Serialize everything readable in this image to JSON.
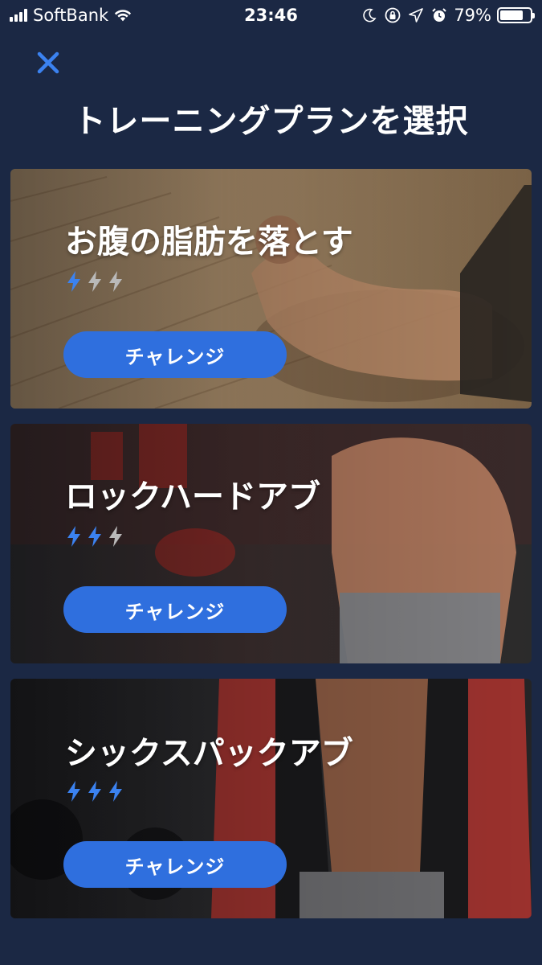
{
  "status_bar": {
    "carrier": "SoftBank",
    "time": "23:46",
    "battery_percent": "79%",
    "battery_level": 0.79,
    "icons": [
      "signal-icon",
      "wifi-icon",
      "moon-icon",
      "rotation-lock-icon",
      "location-icon",
      "alarm-icon",
      "battery-icon"
    ]
  },
  "header": {
    "close_icon": "close-icon",
    "title": "トレーニングプランを選択"
  },
  "plans": [
    {
      "title": "お腹の脂肪を落とす",
      "difficulty": 1,
      "max_difficulty": 3,
      "button_label": "チャレンジ"
    },
    {
      "title": "ロックハードアブ",
      "difficulty": 2,
      "max_difficulty": 3,
      "button_label": "チャレンジ"
    },
    {
      "title": "シックスパックアブ",
      "difficulty": 3,
      "max_difficulty": 3,
      "button_label": "チャレンジ"
    }
  ],
  "colors": {
    "background": "#1b2844",
    "accent": "#2f6fde",
    "bolt_active": "#3b82f0",
    "bolt_inactive": "#b9b9b9"
  }
}
